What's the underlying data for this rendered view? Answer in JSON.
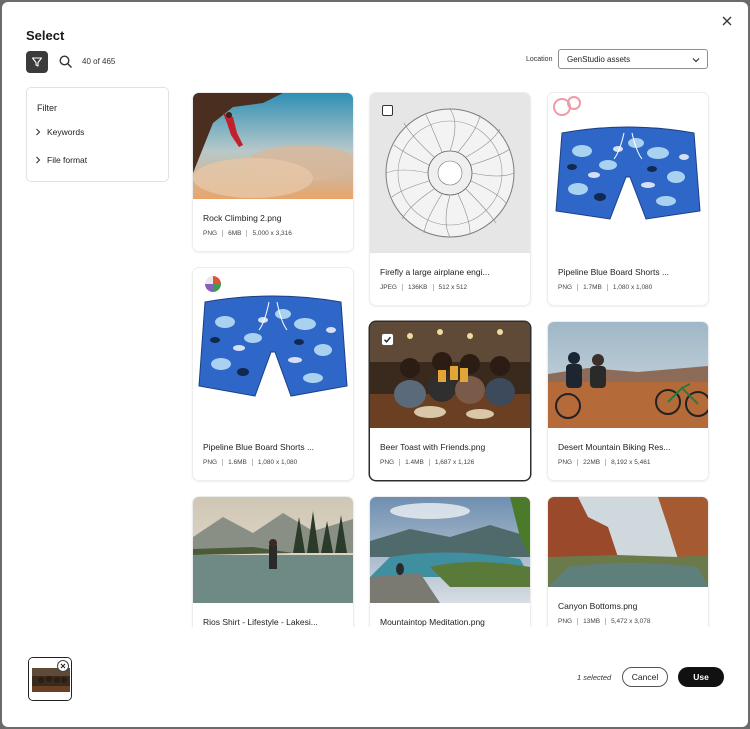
{
  "dialog": {
    "title": "Select"
  },
  "toolbar": {
    "count_text": "40 of 465",
    "location_label": "Location",
    "location_value": "GenStudio assets"
  },
  "filter": {
    "title": "Filter",
    "items": [
      {
        "label": "Keywords"
      },
      {
        "label": "File format"
      }
    ]
  },
  "assets": [
    {
      "name": "Rock Climbing 2.png",
      "type": "PNG",
      "size": "6MB",
      "dims": "5,000 x 3,316",
      "selected": false,
      "icon": "rock-climbing-photo"
    },
    {
      "name": "Firefly a large airplane engi...",
      "type": "JPEG",
      "size": "136KB",
      "dims": "512 x 512",
      "selected": false,
      "icon": "airplane-engine-sketch"
    },
    {
      "name": "Pipeline Blue Board Shorts ...",
      "type": "PNG",
      "size": "1.7MB",
      "dims": "1,080 x 1,080",
      "selected": false,
      "icon": "board-shorts-product"
    },
    {
      "name": "Pipeline Blue Board Shorts ...",
      "type": "PNG",
      "size": "1.6MB",
      "dims": "1,080 x 1,080",
      "selected": false,
      "icon": "board-shorts-product"
    },
    {
      "name": "Beer Toast with Friends.png",
      "type": "PNG",
      "size": "1.4MB",
      "dims": "1,687 x 1,126",
      "selected": true,
      "icon": "friends-toast-photo"
    },
    {
      "name": "Desert Mountain Biking Res...",
      "type": "PNG",
      "size": "22MB",
      "dims": "8,192 x 5,461",
      "selected": false,
      "icon": "desert-biking-photo"
    },
    {
      "name": "Rios Shirt - Lifestyle - Lakesi...",
      "type": "",
      "size": "",
      "dims": "",
      "selected": false,
      "icon": "lakeside-photo"
    },
    {
      "name": "Mountaintop Meditation.png",
      "type": "",
      "size": "",
      "dims": "",
      "selected": false,
      "icon": "mountaintop-photo"
    },
    {
      "name": "Canyon Bottoms.png",
      "type": "PNG",
      "size": "13MB",
      "dims": "5,472 x 3,078",
      "selected": false,
      "icon": "canyon-river-photo"
    }
  ],
  "footer": {
    "selected_text": "1 selected",
    "cancel_label": "Cancel",
    "use_label": "Use"
  },
  "colors": {
    "primary_button": "#111111",
    "filter_toggle": "#3b3b3b",
    "surface": "#ffffff",
    "backdrop": "#6b6b6b"
  },
  "icons": {
    "close": "close-icon",
    "filter": "filter-funnel-icon",
    "search": "search-icon",
    "chevron": "chevron-right-icon",
    "dropdown": "chevron-down-icon"
  }
}
